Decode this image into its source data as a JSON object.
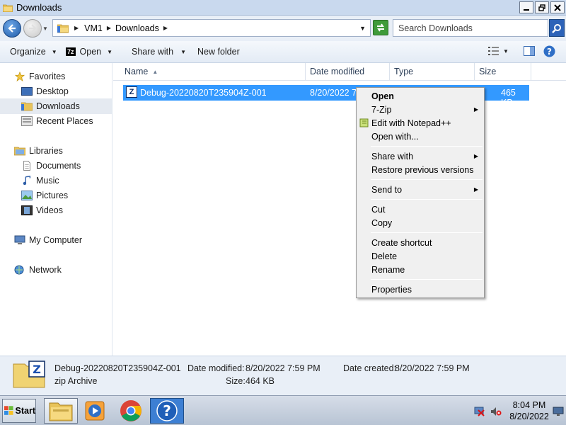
{
  "window": {
    "title": "Downloads"
  },
  "address": {
    "crumbs": [
      "VM1",
      "Downloads"
    ]
  },
  "search": {
    "placeholder": "Search Downloads"
  },
  "toolbar": {
    "organize": "Organize",
    "open": "Open",
    "open_prefix": "7z",
    "share_with": "Share with",
    "new_folder": "New folder"
  },
  "nav": {
    "favorites": "Favorites",
    "desktop": "Desktop",
    "downloads": "Downloads",
    "recent_places": "Recent Places",
    "libraries": "Libraries",
    "documents": "Documents",
    "music": "Music",
    "pictures": "Pictures",
    "videos": "Videos",
    "my_computer": "My Computer",
    "network": "Network"
  },
  "columns": {
    "name": "Name",
    "date_modified": "Date modified",
    "type": "Type",
    "size": "Size"
  },
  "file": {
    "name": "Debug-20220820T235904Z-001",
    "date": "8/20/2022 7:",
    "size": "465 KB"
  },
  "context_menu": {
    "open": "Open",
    "seven_zip": "7-Zip",
    "edit_notepad": "Edit with Notepad++",
    "open_with": "Open with...",
    "share_with": "Share with",
    "restore": "Restore previous versions",
    "send_to": "Send to",
    "cut": "Cut",
    "copy": "Copy",
    "create_shortcut": "Create shortcut",
    "delete": "Delete",
    "rename": "Rename",
    "properties": "Properties"
  },
  "details": {
    "name": "Debug-20220820T235904Z-001",
    "type": "zip Archive",
    "date_modified_label": "Date modified:",
    "date_modified": "8/20/2022 7:59 PM",
    "date_created_label": "Date created:",
    "date_created": "8/20/2022 7:59 PM",
    "size_label": "Size:",
    "size": "464 KB"
  },
  "taskbar": {
    "start": "Start",
    "time": "8:04 PM",
    "date": "8/20/2022"
  },
  "colors": {
    "selection": "#3399ff",
    "titlebar": "#c9d9ee",
    "menu_bg": "#f0f0f0"
  }
}
